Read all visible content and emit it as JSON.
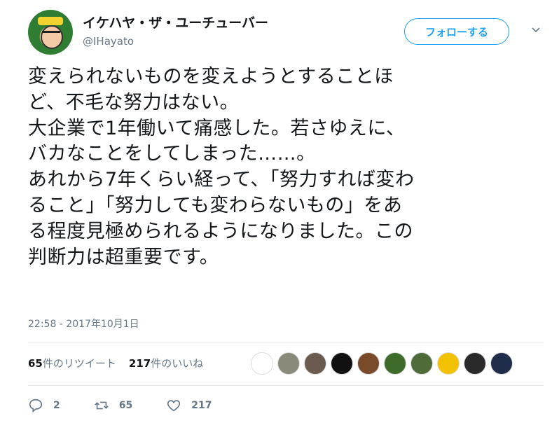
{
  "author": {
    "display_name": "イケハヤ・ザ・ユーチューバー",
    "handle": "@IHayato"
  },
  "follow_button": {
    "label": "フォローする"
  },
  "tweet": {
    "text": "変えられないものを変えようとすることほ\nど、不毛な努力はない。\n大企業で1年働いて痛感した。若さゆえに、\nバカなことをしてしまった……。\nあれから7年くらい経って、「努力すれば変わ\nること」「努力しても変わらないもの」をあ\nる程度見極められるようになりました。この\n判断力は超重要です。",
    "timestamp": "22:58 - 2017年10月1日"
  },
  "stats": {
    "retweets_count": "65",
    "retweets_label": "件のリツイート",
    "likes_count": "217",
    "likes_label": "件のいいね"
  },
  "liker_avatars": [
    {
      "icon": "doodle-avatar",
      "color": "#ffffff"
    },
    {
      "icon": "photo-avatar",
      "color": "#8a8a7a"
    },
    {
      "icon": "anime-avatar",
      "color": "#6b5a4e"
    },
    {
      "icon": "dark-avatar",
      "color": "#111111"
    },
    {
      "icon": "night-avatar",
      "color": "#7a4b2a"
    },
    {
      "icon": "green-avatar",
      "color": "#3d6b2a"
    },
    {
      "icon": "field-avatar",
      "color": "#4f6b3a"
    },
    {
      "icon": "face-avatar",
      "color": "#f2c200"
    },
    {
      "icon": "emblem-avatar",
      "color": "#2a2a2a"
    },
    {
      "icon": "logo-avatar",
      "color": "#1f2d4a"
    }
  ],
  "actions": {
    "reply_count": "2",
    "retweet_count": "65",
    "like_count": "217"
  },
  "colors": {
    "accent": "#1da1f2",
    "text": "#14171a",
    "secondary": "#657786",
    "divider": "#e6ecf0"
  }
}
